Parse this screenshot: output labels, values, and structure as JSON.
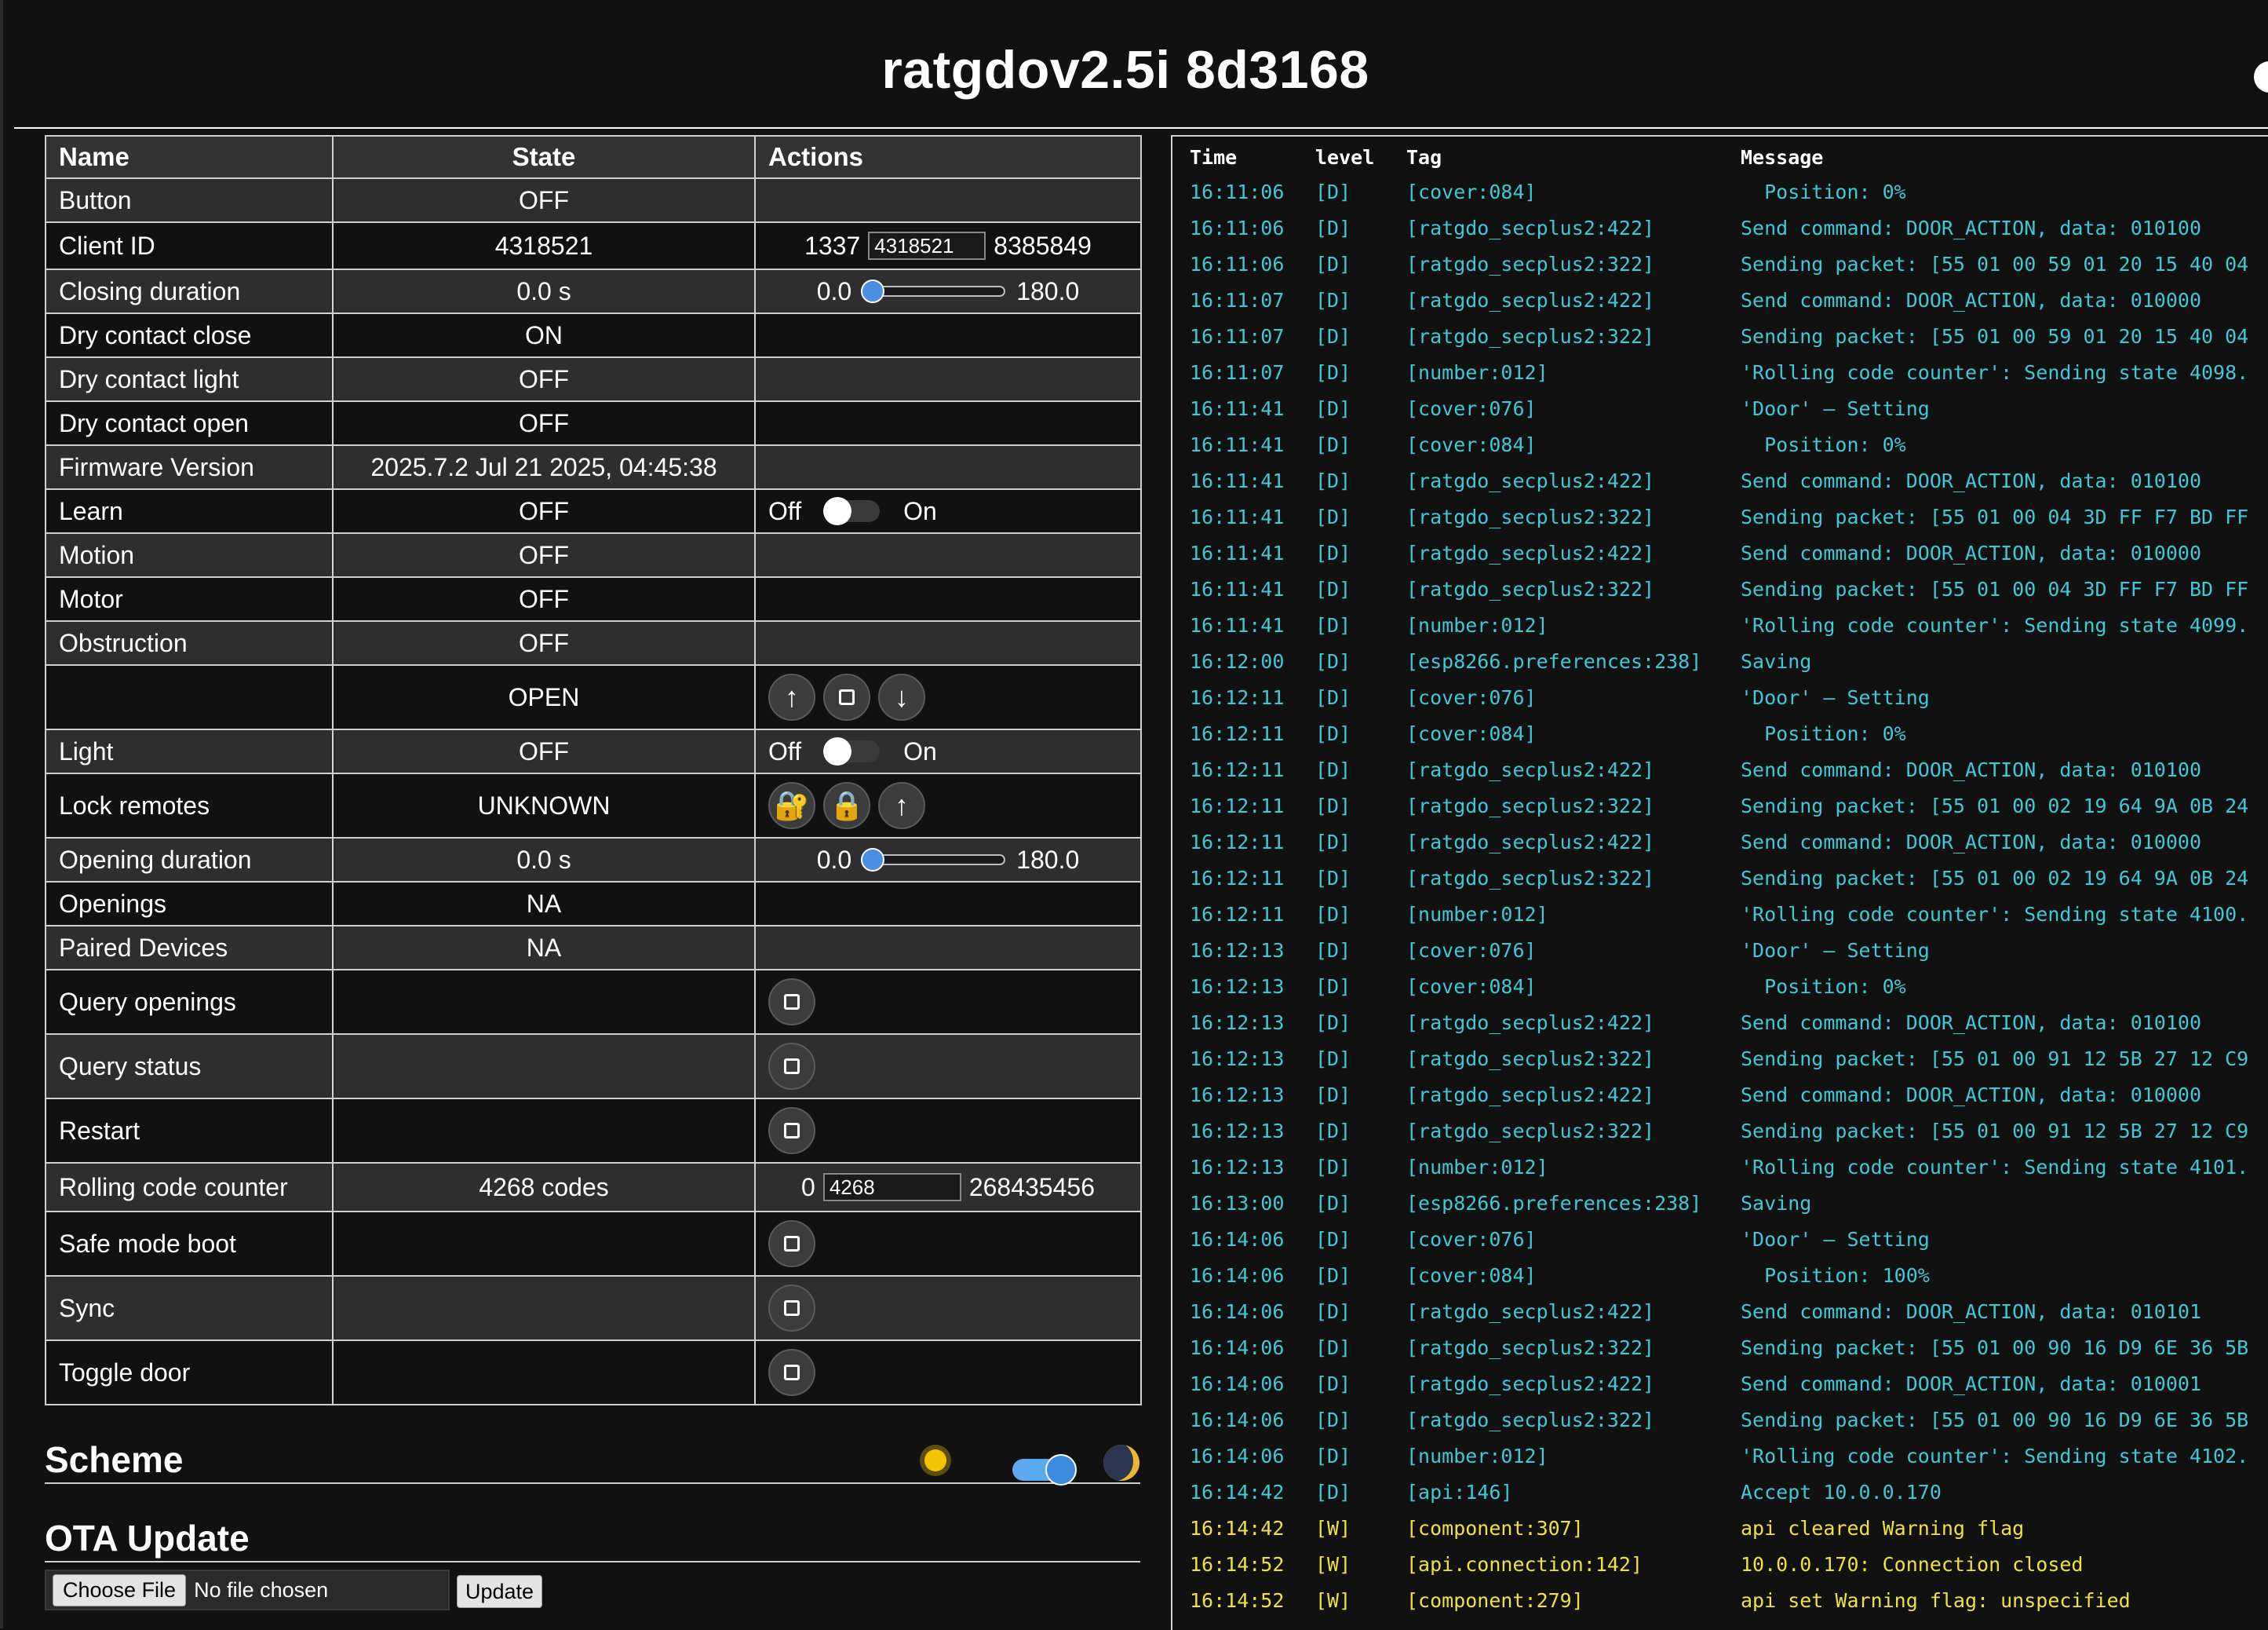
{
  "app": {
    "title": "ratgdov2.5i 8d3168"
  },
  "table": {
    "headers": [
      "Name",
      "State",
      "Actions"
    ],
    "rows": [
      {
        "name": "Button",
        "state": "OFF"
      },
      {
        "name": "Client ID",
        "state": "4318521",
        "min": "1337",
        "value": "4318521",
        "max": "8385849"
      },
      {
        "name": "Closing duration",
        "state": "0.0 s",
        "min": "0.0",
        "max": "180.0",
        "level": 0
      },
      {
        "name": "Dry contact close",
        "state": "ON"
      },
      {
        "name": "Dry contact light",
        "state": "OFF"
      },
      {
        "name": "Dry contact open",
        "state": "OFF"
      },
      {
        "name": "Firmware Version",
        "state": "2025.7.2 Jul 21 2025, 04:45:38"
      },
      {
        "name": "Learn",
        "state": "OFF",
        "off_label": "Off",
        "on_label": "On"
      },
      {
        "name": "Motion",
        "state": "OFF"
      },
      {
        "name": "Motor",
        "state": "OFF"
      },
      {
        "name": "Obstruction",
        "state": "OFF"
      },
      {
        "name": "",
        "state": "OPEN"
      },
      {
        "name": "Light",
        "state": "OFF",
        "off_label": "Off",
        "on_label": "On"
      },
      {
        "name": "Lock remotes",
        "state": "UNKNOWN"
      },
      {
        "name": "Opening duration",
        "state": "0.0 s",
        "min": "0.0",
        "max": "180.0",
        "level": 0
      },
      {
        "name": "Openings",
        "state": "NA"
      },
      {
        "name": "Paired Devices",
        "state": "NA"
      },
      {
        "name": "Query openings",
        "state": ""
      },
      {
        "name": "Query status",
        "state": ""
      },
      {
        "name": "Restart",
        "state": ""
      },
      {
        "name": "Rolling code counter",
        "state": "4268 codes",
        "min": "0",
        "value": "4268",
        "max": "268435456"
      },
      {
        "name": "Safe mode boot",
        "state": ""
      },
      {
        "name": "Sync",
        "state": ""
      },
      {
        "name": "Toggle door",
        "state": ""
      }
    ]
  },
  "scheme": {
    "heading": "Scheme",
    "dark_enabled": true,
    "icons": [
      "sun-icon",
      "moon-icon"
    ]
  },
  "ota": {
    "heading": "OTA Update",
    "choose_label": "Choose File",
    "file_status": "No file chosen",
    "update_label": "Update"
  },
  "log": {
    "headers": [
      "Time",
      "level",
      "Tag",
      "Message"
    ],
    "entries": [
      {
        "time": "16:11:06",
        "level": "[D]",
        "tag": "[cover:084]",
        "msg": "  Position: 0%"
      },
      {
        "time": "16:11:06",
        "level": "[D]",
        "tag": "[ratgdo_secplus2:422]",
        "msg": "Send command: DOOR_ACTION, data: 010100"
      },
      {
        "time": "16:11:06",
        "level": "[D]",
        "tag": "[ratgdo_secplus2:322]",
        "msg": "Sending packet: [55 01 00 59 01 20 15 40 04"
      },
      {
        "time": "16:11:07",
        "level": "[D]",
        "tag": "[ratgdo_secplus2:422]",
        "msg": "Send command: DOOR_ACTION, data: 010000"
      },
      {
        "time": "16:11:07",
        "level": "[D]",
        "tag": "[ratgdo_secplus2:322]",
        "msg": "Sending packet: [55 01 00 59 01 20 15 40 04"
      },
      {
        "time": "16:11:07",
        "level": "[D]",
        "tag": "[number:012]",
        "msg": "'Rolling code counter': Sending state 4098."
      },
      {
        "time": "16:11:41",
        "level": "[D]",
        "tag": "[cover:076]",
        "msg": "'Door' – Setting"
      },
      {
        "time": "16:11:41",
        "level": "[D]",
        "tag": "[cover:084]",
        "msg": "  Position: 0%"
      },
      {
        "time": "16:11:41",
        "level": "[D]",
        "tag": "[ratgdo_secplus2:422]",
        "msg": "Send command: DOOR_ACTION, data: 010100"
      },
      {
        "time": "16:11:41",
        "level": "[D]",
        "tag": "[ratgdo_secplus2:322]",
        "msg": "Sending packet: [55 01 00 04 3D FF F7 BD FF"
      },
      {
        "time": "16:11:41",
        "level": "[D]",
        "tag": "[ratgdo_secplus2:422]",
        "msg": "Send command: DOOR_ACTION, data: 010000"
      },
      {
        "time": "16:11:41",
        "level": "[D]",
        "tag": "[ratgdo_secplus2:322]",
        "msg": "Sending packet: [55 01 00 04 3D FF F7 BD FF"
      },
      {
        "time": "16:11:41",
        "level": "[D]",
        "tag": "[number:012]",
        "msg": "'Rolling code counter': Sending state 4099."
      },
      {
        "time": "16:12:00",
        "level": "[D]",
        "tag": "[esp8266.preferences:238]",
        "msg": "Saving"
      },
      {
        "time": "16:12:11",
        "level": "[D]",
        "tag": "[cover:076]",
        "msg": "'Door' – Setting"
      },
      {
        "time": "16:12:11",
        "level": "[D]",
        "tag": "[cover:084]",
        "msg": "  Position: 0%"
      },
      {
        "time": "16:12:11",
        "level": "[D]",
        "tag": "[ratgdo_secplus2:422]",
        "msg": "Send command: DOOR_ACTION, data: 010100"
      },
      {
        "time": "16:12:11",
        "level": "[D]",
        "tag": "[ratgdo_secplus2:322]",
        "msg": "Sending packet: [55 01 00 02 19 64 9A 0B 24"
      },
      {
        "time": "16:12:11",
        "level": "[D]",
        "tag": "[ratgdo_secplus2:422]",
        "msg": "Send command: DOOR_ACTION, data: 010000"
      },
      {
        "time": "16:12:11",
        "level": "[D]",
        "tag": "[ratgdo_secplus2:322]",
        "msg": "Sending packet: [55 01 00 02 19 64 9A 0B 24"
      },
      {
        "time": "16:12:11",
        "level": "[D]",
        "tag": "[number:012]",
        "msg": "'Rolling code counter': Sending state 4100."
      },
      {
        "time": "16:12:13",
        "level": "[D]",
        "tag": "[cover:076]",
        "msg": "'Door' – Setting"
      },
      {
        "time": "16:12:13",
        "level": "[D]",
        "tag": "[cover:084]",
        "msg": "  Position: 0%"
      },
      {
        "time": "16:12:13",
        "level": "[D]",
        "tag": "[ratgdo_secplus2:422]",
        "msg": "Send command: DOOR_ACTION, data: 010100"
      },
      {
        "time": "16:12:13",
        "level": "[D]",
        "tag": "[ratgdo_secplus2:322]",
        "msg": "Sending packet: [55 01 00 91 12 5B 27 12 C9"
      },
      {
        "time": "16:12:13",
        "level": "[D]",
        "tag": "[ratgdo_secplus2:422]",
        "msg": "Send command: DOOR_ACTION, data: 010000"
      },
      {
        "time": "16:12:13",
        "level": "[D]",
        "tag": "[ratgdo_secplus2:322]",
        "msg": "Sending packet: [55 01 00 91 12 5B 27 12 C9"
      },
      {
        "time": "16:12:13",
        "level": "[D]",
        "tag": "[number:012]",
        "msg": "'Rolling code counter': Sending state 4101."
      },
      {
        "time": "16:13:00",
        "level": "[D]",
        "tag": "[esp8266.preferences:238]",
        "msg": "Saving"
      },
      {
        "time": "16:14:06",
        "level": "[D]",
        "tag": "[cover:076]",
        "msg": "'Door' – Setting"
      },
      {
        "time": "16:14:06",
        "level": "[D]",
        "tag": "[cover:084]",
        "msg": "  Position: 100%"
      },
      {
        "time": "16:14:06",
        "level": "[D]",
        "tag": "[ratgdo_secplus2:422]",
        "msg": "Send command: DOOR_ACTION, data: 010101"
      },
      {
        "time": "16:14:06",
        "level": "[D]",
        "tag": "[ratgdo_secplus2:322]",
        "msg": "Sending packet: [55 01 00 90 16 D9 6E 36 5B"
      },
      {
        "time": "16:14:06",
        "level": "[D]",
        "tag": "[ratgdo_secplus2:422]",
        "msg": "Send command: DOOR_ACTION, data: 010001"
      },
      {
        "time": "16:14:06",
        "level": "[D]",
        "tag": "[ratgdo_secplus2:322]",
        "msg": "Sending packet: [55 01 00 90 16 D9 6E 36 5B"
      },
      {
        "time": "16:14:06",
        "level": "[D]",
        "tag": "[number:012]",
        "msg": "'Rolling code counter': Sending state 4102."
      },
      {
        "time": "16:14:42",
        "level": "[D]",
        "tag": "[api:146]",
        "msg": "Accept 10.0.0.170"
      },
      {
        "time": "16:14:42",
        "level": "[W]",
        "tag": "[component:307]",
        "msg": "api cleared Warning flag"
      },
      {
        "time": "16:14:52",
        "level": "[W]",
        "tag": "[api.connection:142]",
        "msg": "10.0.0.170: Connection closed"
      },
      {
        "time": "16:14:52",
        "level": "[W]",
        "tag": "[component:279]",
        "msg": "api set Warning flag: unspecified"
      }
    ]
  },
  "colors": {
    "debug": "#3fc8d8",
    "warning": "#f0e040",
    "accent": "#4a90e2"
  }
}
